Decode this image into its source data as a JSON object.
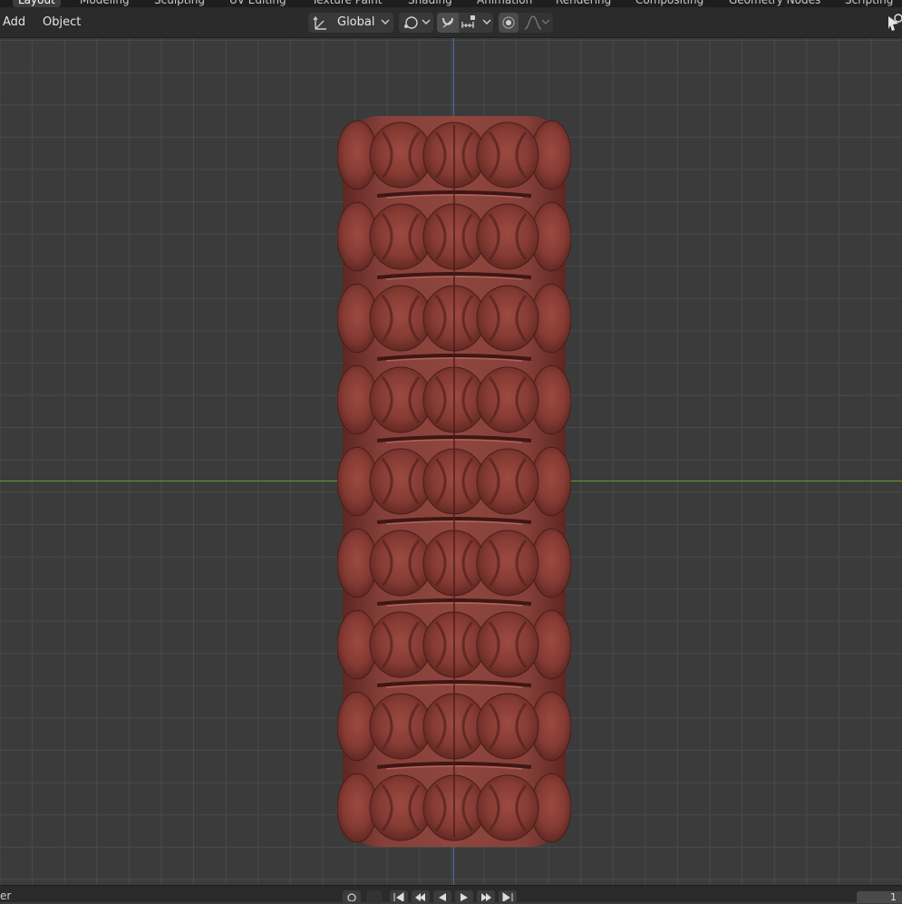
{
  "workspace_tabs": [
    "Layout",
    "Modeling",
    "Sculpting",
    "UV Editing",
    "Texture Paint",
    "Shading",
    "Animation",
    "Rendering",
    "Compositing",
    "Geometry Nodes",
    "Scripting"
  ],
  "header": {
    "menus": [
      "Add",
      "Object"
    ],
    "transform_orientation": "Global"
  },
  "timeline": {
    "label": "er",
    "current_frame": "1"
  },
  "colors": {
    "viewport_bg": "#3b3b3b",
    "grid": "#4a4a4a",
    "x_axis": "#6a9a32",
    "y_axis": "#3f6fa8",
    "object": "#8a4038"
  }
}
